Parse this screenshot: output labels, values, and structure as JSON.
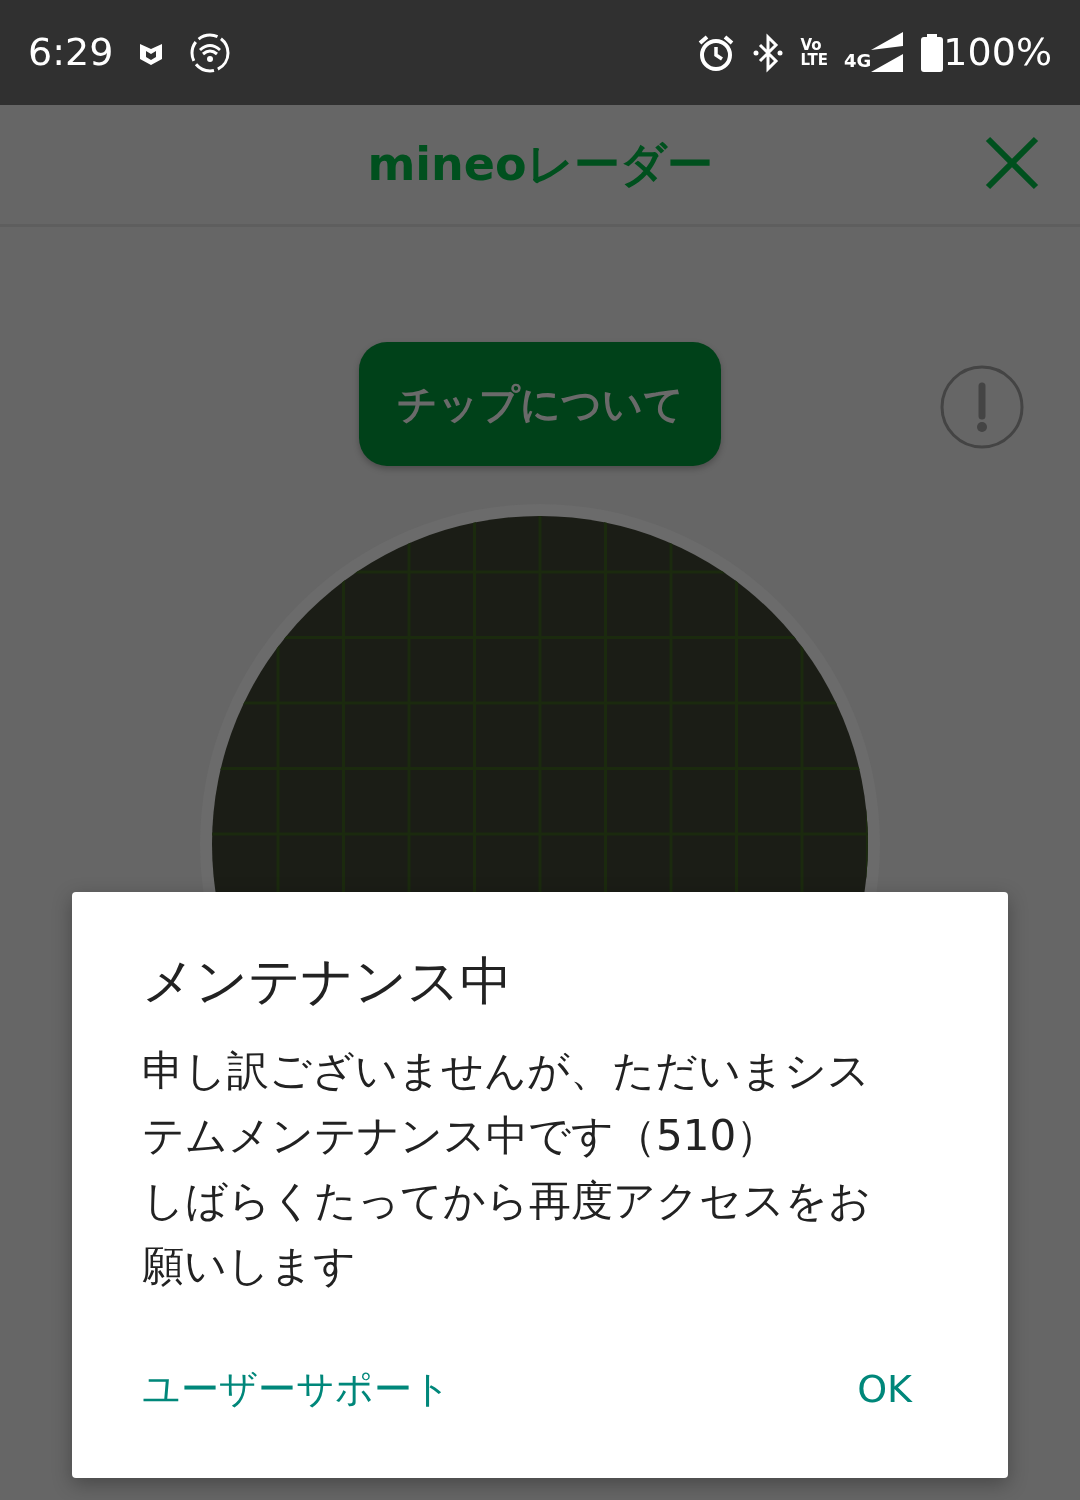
{
  "status_bar": {
    "time": "6:29",
    "volte_top": "Vo",
    "volte_bottom": "LTE",
    "network": "4G",
    "battery": "100%"
  },
  "app_bar": {
    "title": "mineoレーダー"
  },
  "tips_button": {
    "label": "チップについて"
  },
  "dialog": {
    "title": "メンテナンス中",
    "message": [
      "申し訳ございませんが、ただいまシステムメンテナンス中です（510）",
      "しばらくたってから再度アクセスをお願いします"
    ],
    "buttons": [
      {
        "label": "ユーザーサポート",
        "kind": "neutral"
      },
      {
        "label": "OK",
        "kind": "positive"
      }
    ]
  }
}
